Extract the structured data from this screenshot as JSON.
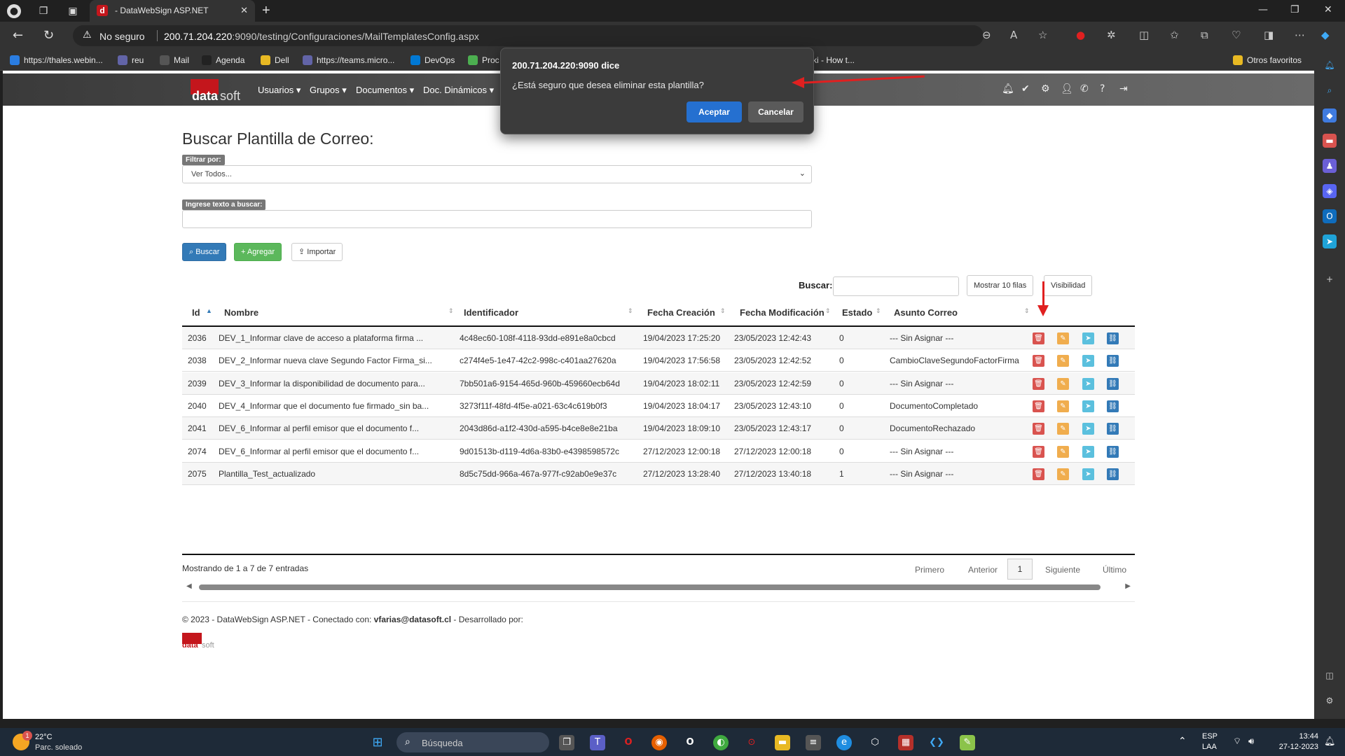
{
  "browser": {
    "tab_title": "- DataWebSign ASP.NET",
    "tab_favicon": "d",
    "security_label": "No seguro",
    "url_host": "200.71.204.220",
    "url_rest": ":9090/testing/Configuraciones/MailTemplatesConfig.aspx",
    "favorites": [
      {
        "label": "https://thales.webin...",
        "color": "#2a7de1"
      },
      {
        "label": "reu",
        "color": "#6264a7"
      },
      {
        "label": "Mail",
        "color": "#555555"
      },
      {
        "label": "Agenda",
        "color": "#222222"
      },
      {
        "label": "Dell",
        "color": "#e8b923"
      },
      {
        "label": "https://teams.micro...",
        "color": "#6264a7"
      },
      {
        "label": "DevOps",
        "color": "#0078d4"
      },
      {
        "label": "Proc",
        "color": "#4caf50"
      },
      {
        "label": "ki - How t...",
        "color": "#333333"
      }
    ],
    "other_favorites": "Otros favoritos"
  },
  "app": {
    "logo_left": "data",
    "logo_right": "soft",
    "menu": [
      "Usuarios",
      "Grupos",
      "Documentos",
      "Doc. Dinámicos"
    ],
    "nav_icons": [
      "bell-icon",
      "check-icon",
      "gear-icon",
      "user-icon",
      "phone-icon",
      "question-icon",
      "logout-icon"
    ]
  },
  "page": {
    "title": "Buscar Plantilla de Correo:",
    "filter_label": "Filtrar por:",
    "filter_value": "Ver Todos...",
    "search_label": "Ingrese texto a buscar:",
    "buttons": {
      "search": "Buscar",
      "add": "Agregar",
      "import": "Importar"
    },
    "table_search_label": "Buscar:",
    "show_rows": "Mostrar 10 filas",
    "visibility": "Visibilidad",
    "columns": [
      "Id",
      "Nombre",
      "Identificador",
      "Fecha Creación",
      "Fecha Modificación",
      "Estado",
      "Asunto Correo"
    ],
    "rows": [
      {
        "id": "2036",
        "nombre": "DEV_1_Informar clave de acceso a plataforma firma ...",
        "ident": "4c48ec60-108f-4118-93dd-e891e8a0cbcd",
        "creacion": "19/04/2023 17:25:20",
        "modif": "23/05/2023 12:42:43",
        "estado": "0",
        "asunto": "--- Sin Asignar ---"
      },
      {
        "id": "2038",
        "nombre": "DEV_2_Informar nueva clave Segundo Factor Firma_si...",
        "ident": "c274f4e5-1e47-42c2-998c-c401aa27620a",
        "creacion": "19/04/2023 17:56:58",
        "modif": "23/05/2023 12:42:52",
        "estado": "0",
        "asunto": "CambioClaveSegundoFactorFirma"
      },
      {
        "id": "2039",
        "nombre": "DEV_3_Informar la disponibilidad de documento para...",
        "ident": "7bb501a6-9154-465d-960b-459660ecb64d",
        "creacion": "19/04/2023 18:02:11",
        "modif": "23/05/2023 12:42:59",
        "estado": "0",
        "asunto": "--- Sin Asignar ---"
      },
      {
        "id": "2040",
        "nombre": "DEV_4_Informar que el documento fue firmado_sin ba...",
        "ident": "3273f11f-48fd-4f5e-a021-63c4c619b0f3",
        "creacion": "19/04/2023 18:04:17",
        "modif": "23/05/2023 12:43:10",
        "estado": "0",
        "asunto": "DocumentoCompletado"
      },
      {
        "id": "2041",
        "nombre": "DEV_6_Informar al perfil emisor que el documento f...",
        "ident": "2043d86d-a1f2-430d-a595-b4ce8e8e21ba",
        "creacion": "19/04/2023 18:09:10",
        "modif": "23/05/2023 12:43:17",
        "estado": "0",
        "asunto": "DocumentoRechazado"
      },
      {
        "id": "2074",
        "nombre": "DEV_6_Informar al perfil emisor que el documento f...",
        "ident": "9d01513b-d119-4d6a-83b0-e4398598572c",
        "creacion": "27/12/2023 12:00:18",
        "modif": "27/12/2023 12:00:18",
        "estado": "0",
        "asunto": "--- Sin Asignar ---"
      },
      {
        "id": "2075",
        "nombre": "Plantilla_Test_actualizado",
        "ident": "8d5c75dd-966a-467a-977f-c92ab0e9e37c",
        "creacion": "27/12/2023 13:28:40",
        "modif": "27/12/2023 13:40:18",
        "estado": "1",
        "asunto": "--- Sin Asignar ---"
      }
    ],
    "info": "Mostrando de 1 a 7 de 7 entradas",
    "pager": {
      "first": "Primero",
      "prev": "Anterior",
      "current": "1",
      "next": "Siguiente",
      "last": "Último"
    },
    "footer_prefix": "© 2023 - DataWebSign ASP.NET - Conectado con: ",
    "footer_user": "vfarias@datasoft.cl",
    "footer_suffix": " - Desarrollado por:"
  },
  "dialog": {
    "title": "200.71.204.220:9090 dice",
    "message": "¿Está seguro que desea eliminar esta plantilla?",
    "ok": "Aceptar",
    "cancel": "Cancelar"
  },
  "taskbar": {
    "weather_temp": "22°C",
    "weather_desc": "Parc. soleado",
    "weather_badge": "1",
    "search_placeholder": "Búsqueda",
    "lang1": "ESP",
    "lang2": "LAA",
    "time": "13:44",
    "date": "27-12-2023"
  }
}
